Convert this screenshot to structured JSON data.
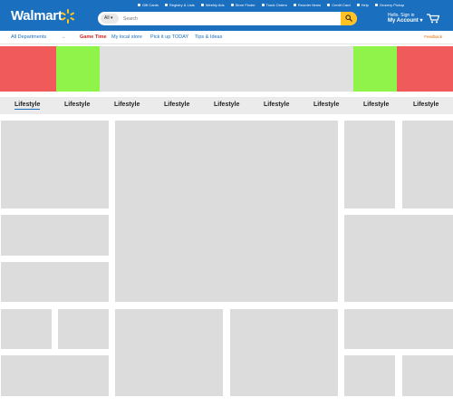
{
  "header": {
    "logo": "Walmart",
    "utility": [
      "Gift Cards",
      "Registry & Lists",
      "Weekly Ads",
      "Store Finder",
      "Track Orders",
      "Reorder Items",
      "Credit Card",
      "Help",
      "Grocery Pickup"
    ],
    "search": {
      "scope": "All",
      "placeholder": "Search"
    },
    "account": {
      "greeting": "Hello. Sign in",
      "label": "My Account"
    }
  },
  "subnav": {
    "departments": "All Departments",
    "links": [
      "Game Time",
      "My local store",
      "Pick it up TODAY",
      "Tips & Ideas"
    ],
    "feedback": "Feedback"
  },
  "colors": {
    "brand": "#1b6fbf",
    "accent": "#ffc220",
    "red": "#f05a5a",
    "green": "#8ff34a"
  },
  "tabs": [
    "Lifestyle",
    "Lifestyle",
    "Lifestyle",
    "Lifestyle",
    "Lifestyle",
    "Lifestyle",
    "Lifestyle",
    "Lifestyle",
    "Lifestyle"
  ]
}
